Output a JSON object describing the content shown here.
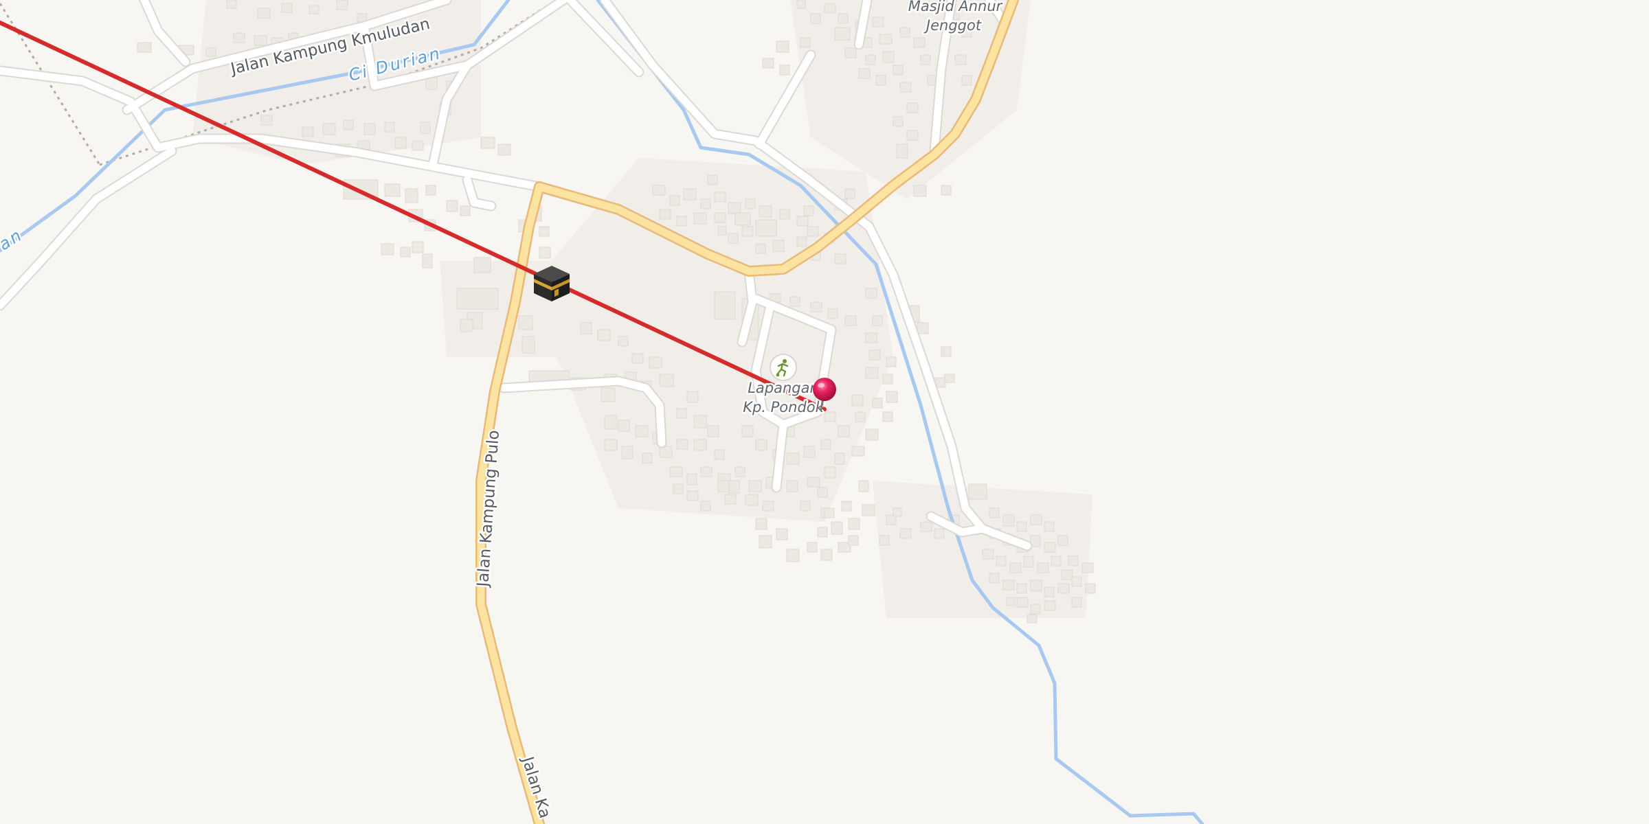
{
  "map": {
    "roads": {
      "kmuludan": "Jalan Kampung Kmuludan",
      "pulo": "Jalan Kampung Pulo",
      "pulo_south": "Jalan Ka"
    },
    "waterways": {
      "river_main": "Ci Durian",
      "river_west_fragment": "ran"
    },
    "pois": {
      "mosque_line1": "Masjid Annur",
      "mosque_line2": "Jenggot",
      "field_line1": "Lapangan",
      "field_line2": "Kp. Pondok"
    },
    "icons": {
      "kaaba": "kaaba-icon",
      "sports_field": "soccer-player-icon",
      "location_pin": "location-pin-icon"
    },
    "colors": {
      "background": "#f8f6f3",
      "minor_road": "#ffffff",
      "major_road": "#fde3a1",
      "water": "#a7c8ef",
      "qibla_line": "#d62b2b",
      "pin": "#e8245e",
      "building": "#ece8e2"
    }
  }
}
